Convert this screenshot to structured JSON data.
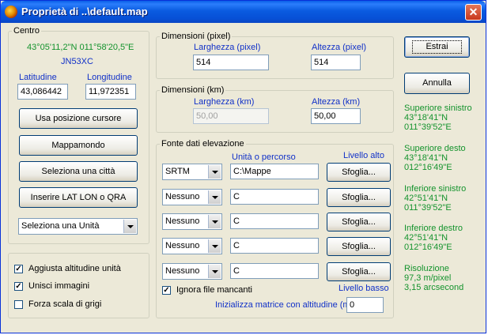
{
  "window": {
    "title": "Proprietà di ..\\default.map"
  },
  "centro": {
    "legend": "Centro",
    "coords": "43°05'11,2\"N 011°58'20,5\"E",
    "qra": "JN53XC",
    "lat_label": "Latitudine",
    "lon_label": "Longitudine",
    "lat_value": "43,086442",
    "lon_value": "11,972351",
    "buttons": {
      "cursor": "Usa posizione cursore",
      "world": "Mappamondo",
      "city": "Seleziona una città",
      "latlon": "Inserire LAT LON o QRA"
    },
    "unit_select": "Seleziona una Unità"
  },
  "options": {
    "adjust_alt": {
      "label": "Aggiusta altitudine unità",
      "checked": true
    },
    "merge": {
      "label": "Unisci immagini",
      "checked": true
    },
    "grayscale": {
      "label": "Forza scala di grigi",
      "checked": false
    }
  },
  "dim_pixel": {
    "legend": "Dimensioni (pixel)",
    "width_label": "Larghezza (pixel)",
    "height_label": "Altezza (pixel)",
    "width_value": "514",
    "height_value": "514"
  },
  "dim_km": {
    "legend": "Dimensioni (km)",
    "width_label": "Larghezza (km)",
    "height_label": "Altezza (km)",
    "width_value": "50,00",
    "height_value": "50,00"
  },
  "elevation": {
    "legend": "Fonte dati elevazione",
    "unit_label": "Unità o percorso",
    "high_label": "Livello alto",
    "low_label": "Livello basso",
    "rows": [
      {
        "source": "SRTM",
        "path": "C:\\Mappe",
        "browse": "Sfoglia..."
      },
      {
        "source": "Nessuno",
        "path": "C",
        "browse": "Sfoglia..."
      },
      {
        "source": "Nessuno",
        "path": "C",
        "browse": "Sfoglia..."
      },
      {
        "source": "Nessuno",
        "path": "C",
        "browse": "Sfoglia..."
      },
      {
        "source": "Nessuno",
        "path": "C",
        "browse": "Sfoglia..."
      }
    ],
    "ignore_missing": {
      "label": "Ignora file mancanti",
      "checked": true
    },
    "init_label": "Inizializza matrice con altitudine (m)",
    "init_value": "0"
  },
  "actions": {
    "extract": "Estrai",
    "cancel": "Annulla"
  },
  "corners": {
    "top_left": {
      "title": "Superiore sinistro",
      "lat": "43°18'41\"N",
      "lon": "011°39'52\"E"
    },
    "top_right": {
      "title": "Superiore desto",
      "lat": "43°18'41\"N",
      "lon": "012°16'49\"E"
    },
    "bottom_left": {
      "title": "Inferiore sinistro",
      "lat": "42°51'41\"N",
      "lon": "011°39'52\"E"
    },
    "bottom_right": {
      "title": "Inferiore destro",
      "lat": "42°51'41\"N",
      "lon": "012°16'49\"E"
    },
    "resolution": {
      "title": "Risoluzione",
      "meters": "97,3 m/pixel",
      "arcsec": "3,15 arcsecond"
    }
  },
  "colors": {
    "title_bar": "#0a5be0",
    "green_text": "#14932d",
    "blue_label": "#1030c8",
    "face": "#ece9d8"
  }
}
